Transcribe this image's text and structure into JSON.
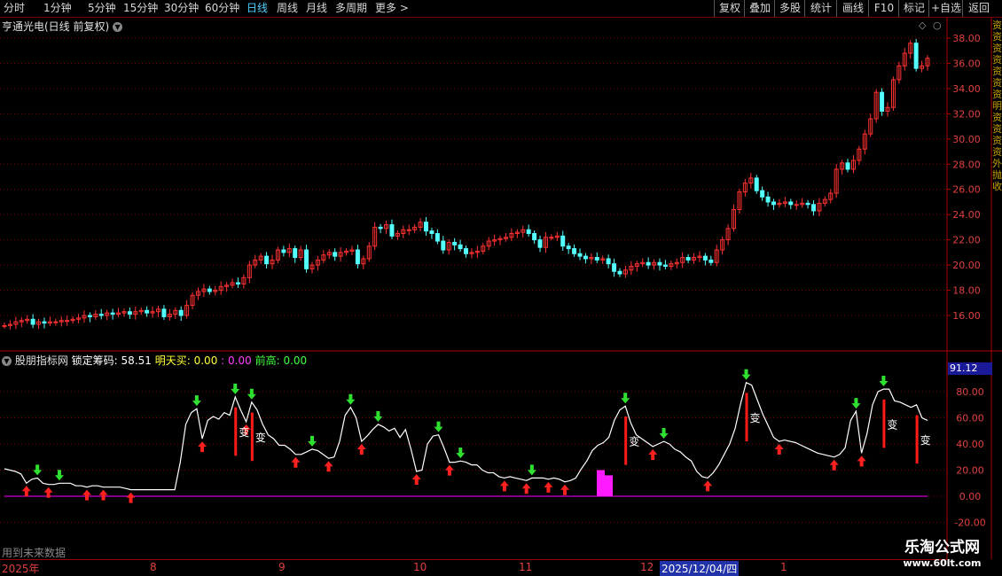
{
  "toolbar": {
    "periods": [
      "分时",
      "1分钟",
      "5分钟",
      "15分钟",
      "30分钟",
      "60分钟",
      "日线",
      "周线",
      "月线",
      "多周期",
      "更多 >"
    ],
    "active_period": "日线",
    "right_buttons": [
      "复权",
      "叠加",
      "多股",
      "统计",
      "画线",
      "F10",
      "标记",
      "+自选",
      "返回"
    ]
  },
  "chart_title": "亨通光电(日线 前复权)",
  "price_axis": {
    "ticks": [
      "38.00",
      "36.00",
      "34.00",
      "32.00",
      "30.00",
      "28.00",
      "26.00",
      "24.00",
      "22.00",
      "20.00",
      "18.00",
      "16.00"
    ],
    "ylim": [
      14.4,
      39.2
    ]
  },
  "indicator": {
    "name": "股朋指标网",
    "lock_label": "锁定筹码:",
    "lock_value": "58.51",
    "buy_label": "明天买:",
    "buy_value": "0.00",
    "colon": ":",
    "extra_value": "0.00",
    "high_label": "前高:",
    "high_value": "0.00",
    "current_value": "91.12",
    "ticks": [
      "80.00",
      "60.00",
      "40.00",
      "20.00",
      "0.00",
      "-20.00"
    ],
    "change_label": "变"
  },
  "bottom_note": "用到未来数据",
  "date_axis": {
    "labels": [
      "2025年",
      "8",
      "9",
      "10",
      "11",
      "12",
      "1"
    ],
    "highlight": "2025/12/04/四"
  },
  "right_strip_text": "资资资资资资资明资资资资外抛收",
  "watermark": {
    "line1": "乐淘公式网",
    "line2": "www.60lt.com"
  },
  "colors": {
    "up": "#ff3232",
    "down": "#54ffff",
    "indicator_line": "#ffffff",
    "baseline": "#ff00ff",
    "grid": "#800000"
  },
  "chart_data": [
    {
      "type": "candlestick",
      "title": "亨通光电(日线 前复权)",
      "ylim": [
        14.4,
        39.2
      ],
      "values": [
        15.2,
        15.3,
        15.5,
        15.6,
        15.7,
        15.3,
        15.5,
        15.4,
        15.5,
        15.5,
        15.6,
        15.6,
        15.7,
        15.8,
        16.0,
        15.9,
        16.1,
        16.0,
        16.2,
        16.1,
        16.2,
        16.3,
        16.1,
        16.3,
        16.4,
        16.2,
        16.3,
        16.5,
        15.9,
        16.1,
        16.4,
        16.0,
        16.8,
        17.6,
        17.9,
        18.1,
        17.9,
        18.0,
        18.3,
        18.4,
        18.6,
        18.5,
        19.0,
        20.0,
        20.4,
        20.7,
        20.1,
        20.4,
        21.2,
        21.0,
        21.3,
        20.6,
        21.2,
        19.7,
        20.0,
        20.4,
        20.8,
        21.0,
        20.7,
        21.0,
        21.1,
        21.2,
        20.1,
        20.5,
        21.5,
        23.0,
        22.9,
        23.2,
        22.3,
        22.5,
        22.8,
        22.8,
        23.0,
        23.4,
        22.7,
        22.5,
        21.9,
        21.2,
        21.8,
        21.6,
        21.3,
        20.9,
        21.0,
        21.1,
        21.5,
        21.9,
        22.0,
        22.1,
        22.2,
        22.5,
        22.6,
        22.8,
        22.5,
        22.0,
        21.4,
        22.2,
        22.2,
        22.3,
        21.5,
        21.3,
        20.9,
        20.7,
        20.5,
        20.6,
        20.4,
        20.5,
        20.1,
        19.5,
        19.3,
        19.6,
        19.9,
        20.1,
        20.2,
        20.0,
        20.2,
        20.0,
        19.9,
        20.1,
        20.2,
        20.6,
        20.4,
        20.6,
        20.7,
        20.4,
        20.2,
        21.2,
        22.0,
        22.9,
        24.4,
        25.8,
        26.5,
        26.9,
        25.9,
        25.4,
        25.0,
        24.8,
        24.9,
        25.0,
        24.8,
        24.8,
        24.9,
        24.8,
        24.3,
        24.9,
        25.2,
        25.7,
        27.6,
        28.1,
        27.6,
        28.3,
        29.2,
        30.4,
        31.6,
        33.7,
        32.2,
        32.5,
        34.7,
        35.8,
        36.8,
        37.6,
        35.6,
        35.8,
        36.4
      ]
    },
    {
      "type": "line",
      "name": "锁定筹码",
      "ylim": [
        -25,
        100
      ],
      "values": [
        21,
        20,
        19,
        17,
        10,
        13,
        14,
        10,
        9,
        9,
        10,
        10,
        10,
        8,
        8,
        7,
        8,
        8,
        7,
        7,
        7,
        7,
        6,
        5,
        5,
        5,
        5,
        5,
        5,
        5,
        5,
        5,
        26,
        55,
        64,
        67,
        44,
        58,
        61,
        59,
        64,
        62,
        76,
        66,
        57,
        72,
        66,
        55,
        47,
        44,
        39,
        39,
        36,
        32,
        32,
        34,
        36,
        35,
        32,
        29,
        30,
        42,
        62,
        68,
        60,
        42,
        46,
        51,
        55,
        53,
        50,
        52,
        45,
        51,
        36,
        19,
        20,
        40,
        46,
        47,
        37,
        26,
        26,
        27,
        26,
        24,
        24,
        20,
        18,
        18,
        15,
        14,
        15,
        14,
        13,
        12,
        14,
        14,
        14,
        13,
        14,
        13,
        11,
        12,
        14,
        21,
        27,
        35,
        39,
        41,
        45,
        58,
        66,
        69,
        56,
        47,
        44,
        41,
        38,
        40,
        42,
        40,
        36,
        34,
        30,
        27,
        19,
        15,
        14,
        18,
        24,
        32,
        40,
        52,
        71,
        87,
        85,
        74,
        63,
        54,
        45,
        42,
        43,
        42,
        41,
        39,
        37,
        35,
        33,
        32,
        31,
        30,
        32,
        37,
        58,
        65,
        33,
        48,
        70,
        80,
        82,
        82,
        73,
        72,
        70,
        68,
        70,
        60,
        58
      ]
    }
  ]
}
